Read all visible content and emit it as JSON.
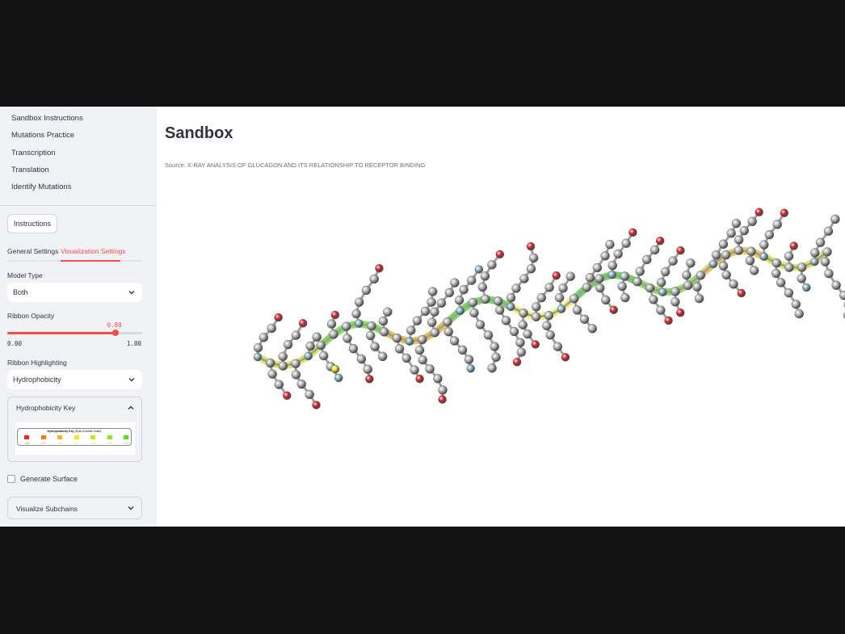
{
  "sidebar": {
    "nav": [
      "Sandbox Instructions",
      "Mutations Practice",
      "Transcription",
      "Translation",
      "Identify Mutations"
    ],
    "instructions_button": "Instructions",
    "tabs": [
      "General Settings",
      "Visualization Settings"
    ],
    "active_tab": "Visualization Settings",
    "model_type": {
      "label": "Model Type",
      "value": "Both"
    },
    "ribbon_opacity": {
      "label": "Ribbon Opacity",
      "value_text": "0.80",
      "min_text": "0.00",
      "max_text": "1.00",
      "value": 0.8,
      "min": 0,
      "max": 1
    },
    "ribbon_highlighting": {
      "label": "Ribbon Highlighting",
      "value": "Hydrophobicity"
    },
    "key_expander": {
      "title": "Hydrophobicity Key",
      "key_title_bold": "Hydrophobicity Key",
      "key_title_rest": "(Kyte-Doolittle Scale)",
      "scale": [
        {
          "label": "-4.5",
          "color": "#e8291b"
        },
        {
          "label": "-3.0",
          "color": "#f07c16"
        },
        {
          "label": "-1.5",
          "color": "#f4b41b"
        },
        {
          "label": "0.0",
          "color": "#f5e61a"
        },
        {
          "label": "1.5",
          "color": "#c8e61a"
        },
        {
          "label": "3.0",
          "color": "#8ee61a"
        },
        {
          "label": "4.5",
          "color": "#4ae61a"
        }
      ]
    },
    "generate_surface": {
      "label": "Generate Surface",
      "checked": false
    },
    "subchains_expander": {
      "title": "Visualize Subchains"
    }
  },
  "main": {
    "title": "Sandbox",
    "source": "Source: X-RAY ANALYSIS OF GLUCAGON AND ITS RELATIONSHIP TO RECEPTOR BINDING"
  },
  "colors": {
    "accent": "#ff4b4b",
    "carbon": "#b7b7b7",
    "oxygen": "#e0222a",
    "nitrogen": "#8ab4c6",
    "sulfur": "#f2e21a"
  },
  "molecule": {
    "ribbon_colors": [
      "#d8e64a",
      "#6fde3a",
      "#e2b43a",
      "#5ed43a",
      "#f0f060",
      "#58d040",
      "#7ed84a",
      "#e8c040",
      "#d6e44a",
      "#8ee040"
    ]
  }
}
